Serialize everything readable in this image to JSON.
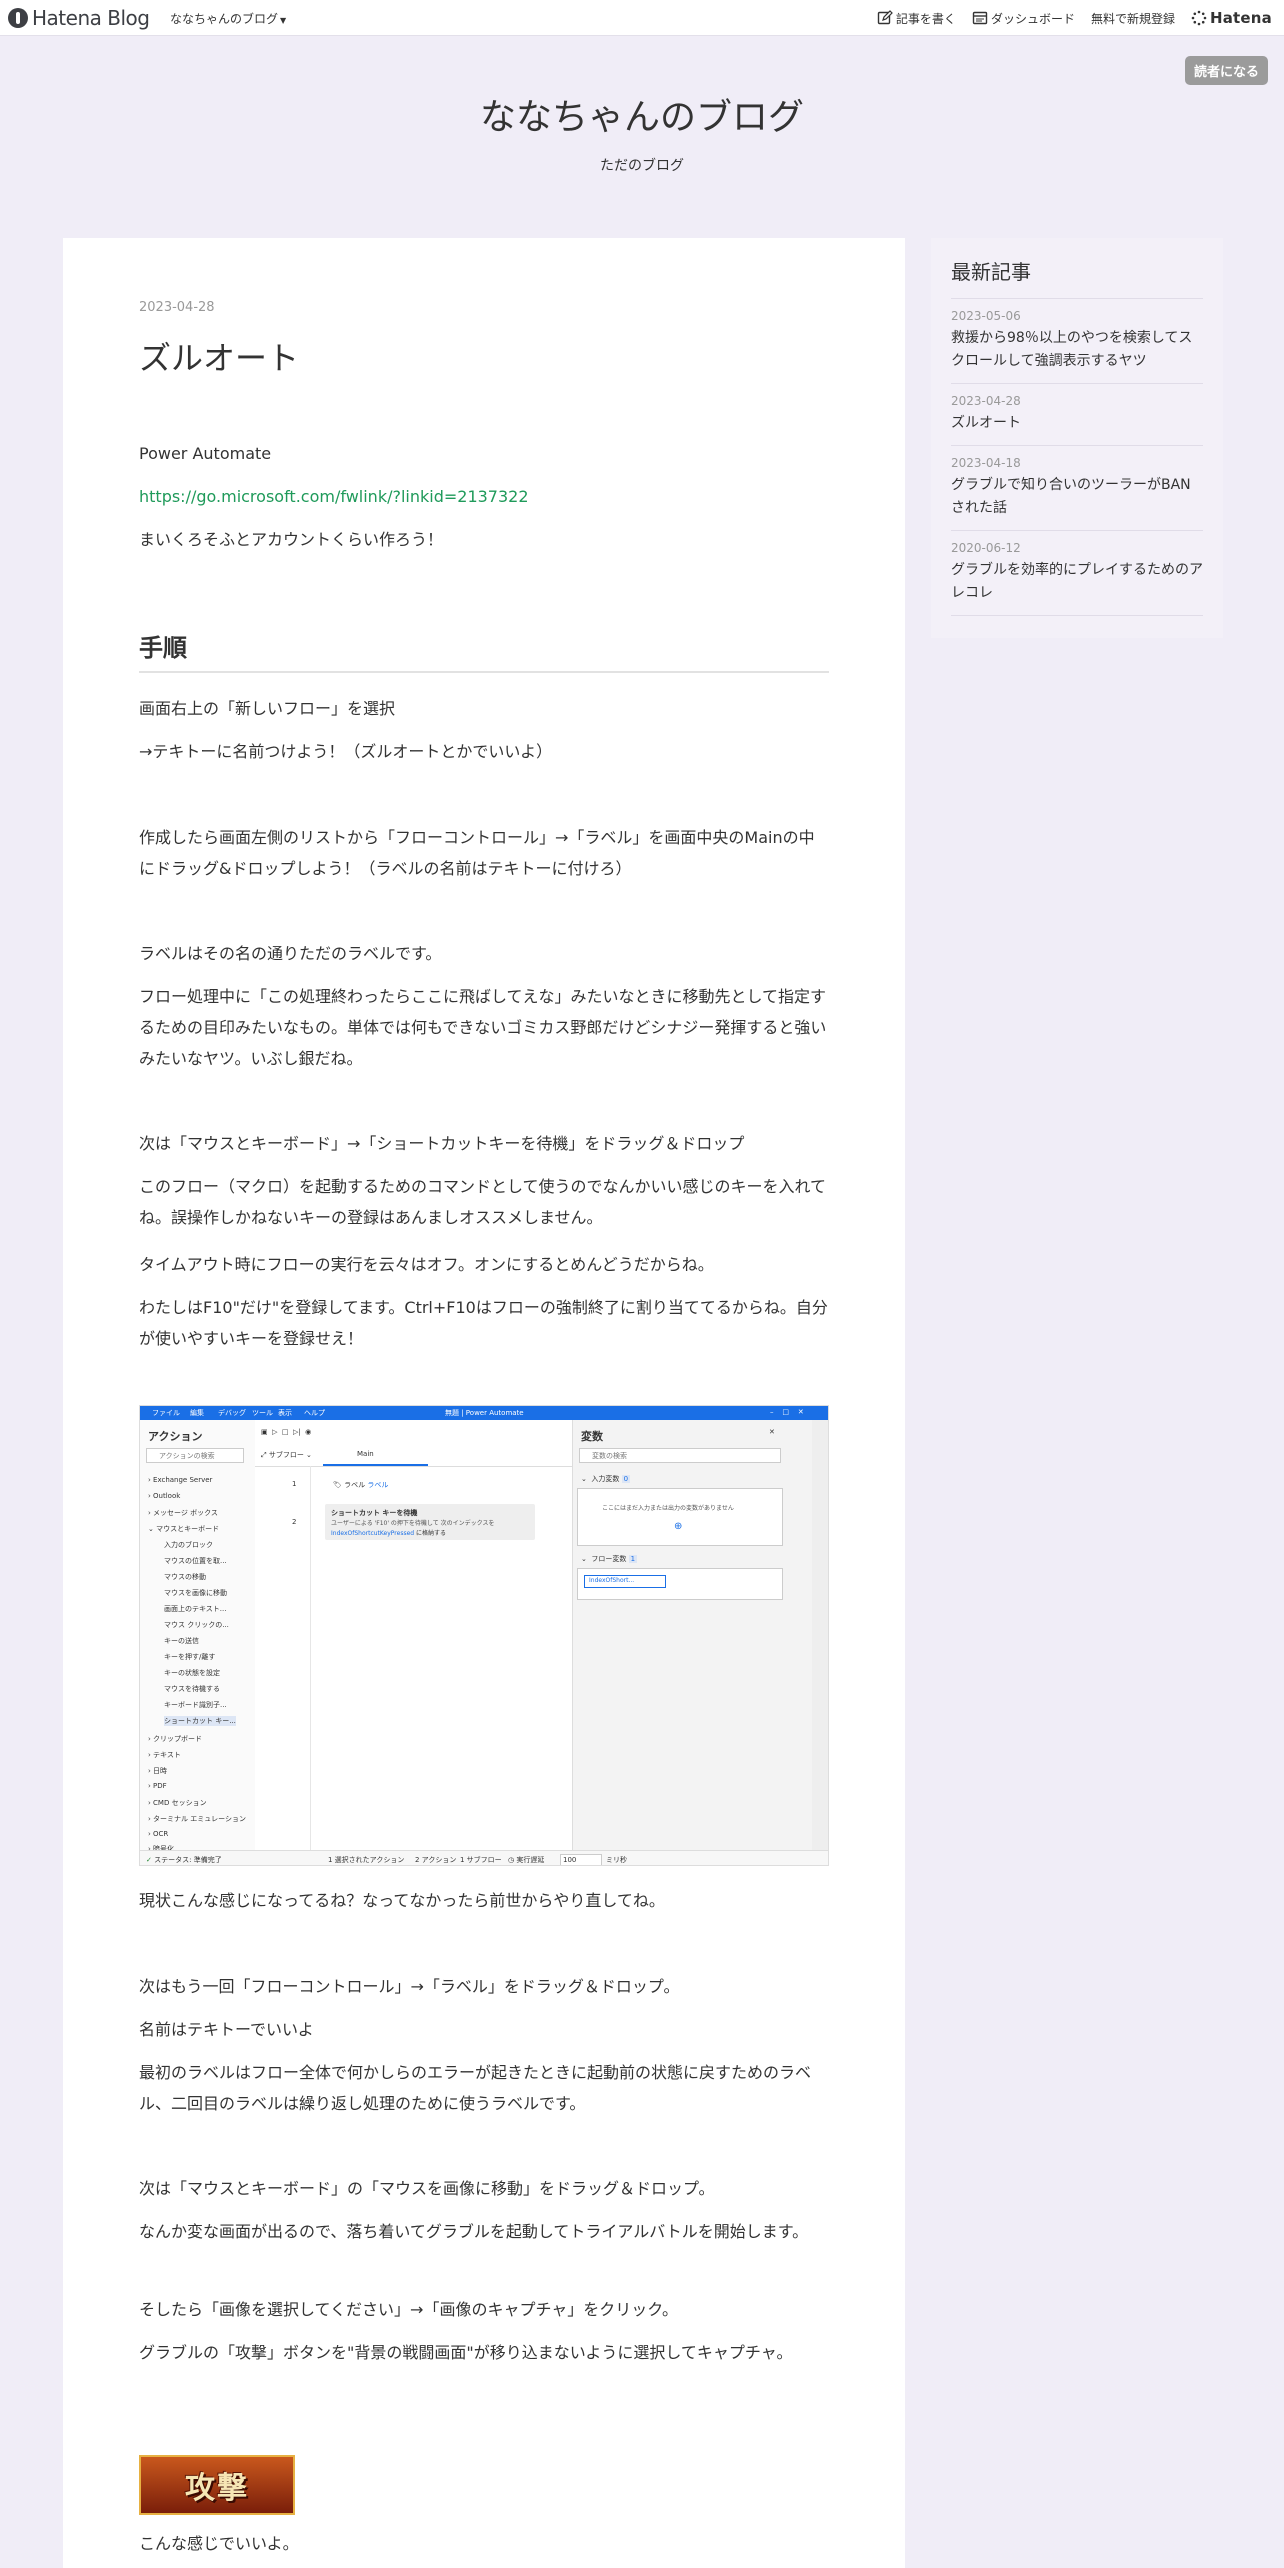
{
  "topbar": {
    "logo_text": "Hatena Blog",
    "blog_dropdown": "ななちゃんのブログ",
    "write": "記事を書く",
    "dashboard": "ダッシュボード",
    "signup": "無料で新規登録",
    "hatena": "Hatena"
  },
  "subscribe_label": "読者になる",
  "blog": {
    "title": "ななちゃんのブログ",
    "description": "ただのブログ"
  },
  "article": {
    "date": "2023-04-28",
    "title": "ズルオート",
    "p1": "Power Automate",
    "link": "https://go.microsoft.com/fwlink/?linkid=2137322",
    "p2": "まいくろそふとアカウントくらい作ろう！",
    "section_heading": "手順",
    "p3": "画面右上の「新しいフロー」を選択",
    "p4": "→テキトーに名前つけよう！（ズルオートとかでいいよ）",
    "p5": "作成したら画面左側のリストから「フローコントロール」→「ラベル」を画面中央のMainの中にドラッグ&ドロップしよう！（ラベルの名前はテキトーに付けろ）",
    "p6": "ラベルはその名の通りただのラベルです。",
    "p7": "フロー処理中に「この処理終わったらここに飛ばしてえな」みたいなときに移動先として指定するための目印みたいなもの。単体では何もできないゴミカス野郎だけどシナジー発揮すると強いみたいなヤツ。いぶし銀だね。",
    "p8": "次は「マウスとキーボード」→「ショートカットキーを待機」をドラッグ＆ドロップ",
    "p9": "このフロー（マクロ）を起動するためのコマンドとして使うのでなんかいい感じのキーを入れてね。誤操作しかねないキーの登録はあんましオススメしません。",
    "p10": "タイムアウト時にフローの実行を云々はオフ。オンにするとめんどうだからね。",
    "p11": "わたしはF10\"だけ\"を登録してます。Ctrl+F10はフローの強制終了に割り当ててるからね。自分が使いやすいキーを登録せえ！",
    "p12": "現状こんな感じになってるね？なってなかったら前世からやり直してね。",
    "p13": "次はもう一回「フローコントロール」→「ラベル」をドラッグ＆ドロップ。",
    "p14": "名前はテキトーでいいよ",
    "p15": "最初のラベルはフロー全体で何かしらのエラーが起きたときに起動前の状態に戻すためのラベル、二回目のラベルは繰り返し処理のために使うラベルです。",
    "p16": "次は「マウスとキーボード」の「マウスを画像に移動」をドラッグ＆ドロップ。",
    "p17": "なんか変な画面が出るので、落ち着いてグラブルを起動してトライアルバトルを開始します。",
    "p18": "そしたら「画像を選択してください」→「画像のキャプチャ」をクリック。",
    "p19": "グラブルの「攻撃」ボタンを\"背景の戦闘画面\"が移り込まないように選択してキャプチャ。",
    "attack_text": "攻撃",
    "p20": "こんな感じでいいよ。"
  },
  "screenshot": {
    "menu": [
      "ファイル",
      "編集",
      "デバッグ",
      "ツール",
      "表示",
      "ヘルプ"
    ],
    "window_title": "無題 | Power Automate",
    "actions_title": "アクション",
    "actions_search": "アクションの検索",
    "subflow": "サブフロー",
    "main_tab": "Main",
    "step1": "ラベル",
    "step1_name": "ラベル",
    "step2_title": "ショートカット キーを待機",
    "step2_desc": "ユーザーによる 'F10' の押下を待機して 次のインデックスを",
    "step2_var": "IndexOfShortcutKeyPressed",
    "step2_suffix": "に格納する",
    "tree": [
      "Exchange Server",
      "Outlook",
      "メッセージ ボックス",
      "マウスとキーボード",
      "入力のブロック",
      "マウスの位置を取...",
      "マウスの移動",
      "マウスを画像に移動",
      "画面上のテキスト...",
      "マウス クリックの...",
      "キーの送信",
      "キーを押す/離す",
      "キーの状態を設定",
      "マウスを待機する",
      "キーボード識別子...",
      "ショートカット キー...",
      "クリップボード",
      "テキスト",
      "日時",
      "PDF",
      "CMD セッション",
      "ターミナル エミュレーション",
      "OCR",
      "暗号化"
    ],
    "variables_title": "変数",
    "var_search": "変数の検索",
    "input_vars": "入力変数",
    "input_count": "0",
    "input_empty": "ここにはまだ入力または出力の変数がありません",
    "flow_vars": "フロー変数",
    "flow_count": "1",
    "flow_var_chip": "IndexOfShort...",
    "status_ready": "ステータス: 準備完了",
    "status_selected": "1 選択されたアクション",
    "status_actions": "2 アクション",
    "status_subflow": "1 サブフロー",
    "status_delay": "実行遅延",
    "status_delay_value": "100",
    "status_ms": "ミリ秒"
  },
  "sidebar": {
    "title": "最新記事",
    "items": [
      {
        "date": "2023-05-06",
        "title": "救援から98％以上のやつを検索してスクロールして強調表示するヤツ"
      },
      {
        "date": "2023-04-28",
        "title": "ズルオート"
      },
      {
        "date": "2023-04-18",
        "title": "グラブルで知り合いのツーラーがBANされた話"
      },
      {
        "date": "2020-06-12",
        "title": "グラブルを効率的にプレイするためのアレコレ"
      }
    ]
  }
}
